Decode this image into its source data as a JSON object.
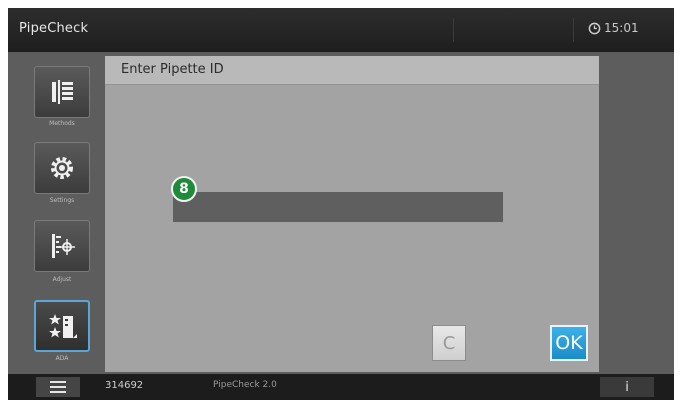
{
  "app": {
    "title": "PipeCheck",
    "time": "15:01"
  },
  "sidebar": {
    "items": [
      {
        "label": "Methods",
        "icon": "methods-icon"
      },
      {
        "label": "Settings",
        "icon": "settings-gear-icon"
      },
      {
        "label": "Adjust",
        "icon": "adjust-icon"
      },
      {
        "label": "ADA",
        "icon": "ada-icon",
        "selected": true
      }
    ]
  },
  "dialog": {
    "title": "Enter Pipette ID",
    "input_value": "",
    "marker_label": "8",
    "clear_label": "C",
    "ok_label": "OK"
  },
  "footer": {
    "serial": "314692",
    "version": "PipeCheck 2.0",
    "info_label": "i"
  },
  "colors": {
    "ok_button": "#1b9ad6",
    "marker": "#1f8a3a",
    "dialog_bg": "#a3a3a3"
  }
}
